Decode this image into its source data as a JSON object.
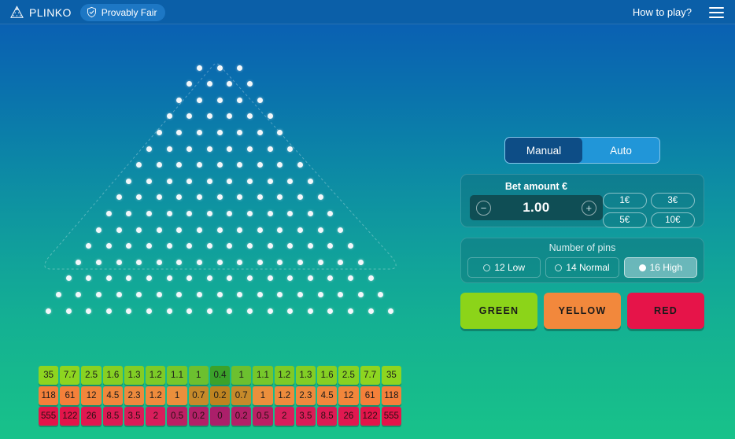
{
  "header": {
    "brand": "PLINKO",
    "provably_fair": "Provably Fair",
    "how_to_play": "How to play?"
  },
  "panel": {
    "tabs": [
      {
        "label": "Manual",
        "active": true
      },
      {
        "label": "Auto",
        "active": false
      }
    ],
    "bet": {
      "title": "Bet amount €",
      "value": "1.00",
      "minus": "−",
      "plus": "+",
      "quick_amounts": [
        "1€",
        "3€",
        "5€",
        "10€"
      ]
    },
    "pins": {
      "title": "Number of pins",
      "options": [
        {
          "label": "12 Low",
          "selected": false
        },
        {
          "label": "14 Normal",
          "selected": false
        },
        {
          "label": "16 High",
          "selected": true
        }
      ]
    },
    "risk_buttons": [
      {
        "label": "GREEN",
        "color": "#8cd419"
      },
      {
        "label": "YELLOW",
        "color": "#f2883c"
      },
      {
        "label": "RED",
        "color": "#e61449"
      }
    ]
  },
  "board": {
    "pin_rows": [
      3,
      4,
      5,
      6,
      7,
      8,
      9,
      10,
      11,
      12,
      13,
      14,
      15,
      16,
      17,
      18
    ],
    "multipliers": {
      "green": {
        "values": [
          "35",
          "7.7",
          "2.5",
          "1.6",
          "1.3",
          "1.2",
          "1.1",
          "1",
          "0.4",
          "1",
          "1.1",
          "1.2",
          "1.3",
          "1.6",
          "2.5",
          "7.7",
          "35"
        ],
        "colors": [
          "#8ed520",
          "#8ed520",
          "#88d222",
          "#86d023",
          "#82ce25",
          "#7dcb27",
          "#76c72b",
          "#6cc02f",
          "#3ba22a",
          "#6cc02f",
          "#76c72b",
          "#7dcb27",
          "#82ce25",
          "#86d023",
          "#88d222",
          "#8ed520",
          "#8ed520"
        ]
      },
      "yellow": {
        "values": [
          "118",
          "61",
          "12",
          "4.5",
          "2.3",
          "1.2",
          "1",
          "0.7",
          "0.2",
          "0.7",
          "1",
          "1.2",
          "2.3",
          "4.5",
          "12",
          "61",
          "118"
        ],
        "colors": [
          "#f4803a",
          "#f4803a",
          "#f2863b",
          "#f0883c",
          "#ee8a3d",
          "#ef8b3c",
          "#eb8f3c",
          "#c68a2a",
          "#bf8420",
          "#c68a2a",
          "#eb8f3c",
          "#ef8b3c",
          "#ee8a3d",
          "#f0883c",
          "#f2863b",
          "#f4803a",
          "#f4803a"
        ]
      },
      "red": {
        "values": [
          "555",
          "122",
          "26",
          "8.5",
          "3.5",
          "2",
          "0.5",
          "0.2",
          "0",
          "0.2",
          "0.5",
          "2",
          "3.5",
          "8.5",
          "26",
          "122",
          "555"
        ],
        "colors": [
          "#e3154a",
          "#e3154a",
          "#e01850",
          "#dd1a54",
          "#da1c58",
          "#d81e5c",
          "#bc2064",
          "#b32068",
          "#ab1f6a",
          "#b32068",
          "#bc2064",
          "#d81e5c",
          "#da1c58",
          "#dd1a54",
          "#e01850",
          "#e3154a",
          "#e3154a"
        ]
      }
    }
  }
}
